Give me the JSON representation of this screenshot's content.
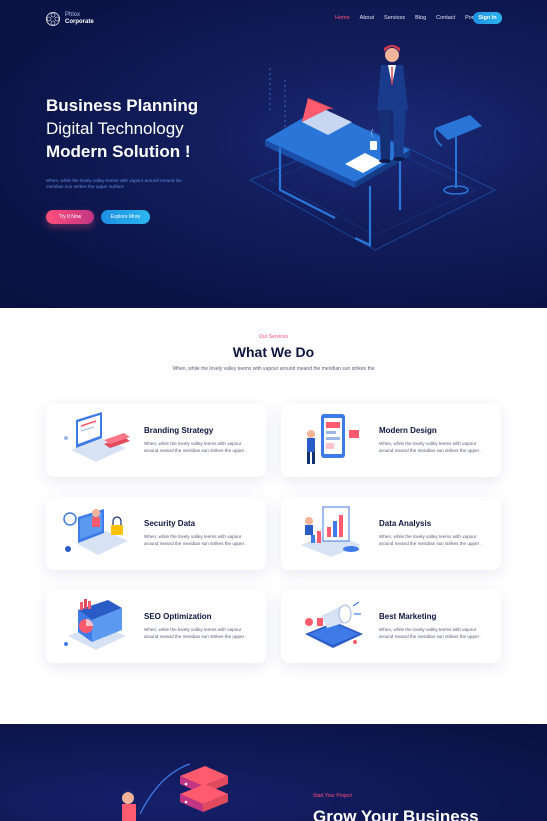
{
  "brand": {
    "line1": "Phlox",
    "line2": "Corporate"
  },
  "nav": {
    "items": [
      {
        "label": "Home"
      },
      {
        "label": "About"
      },
      {
        "label": "Services"
      },
      {
        "label": "Blog"
      },
      {
        "label": "Contact"
      },
      {
        "label": "Portfolio"
      }
    ],
    "signin": "Sign In",
    "active_color": "#ff4f7b"
  },
  "hero": {
    "line1": "Business Planning",
    "line2": "Digital Technology",
    "line3": "Modern Solution !",
    "subtitle": "When, while the lovely valley teems with vapour around meand the meridian sun strikes the upper surface",
    "btn_primary": "Try It Now",
    "btn_secondary": "Explore More"
  },
  "services": {
    "eyebrow": "Our Services",
    "title_bold": "What",
    "title_rest": " We Do",
    "description": "When, while the lovely valley teems with vapour around meand the meridian sun strikes the",
    "cards": [
      {
        "title": "Branding Strategy",
        "text": "When, while the lovely valley teems with vapour around meand the meridian sun strikes the upper .",
        "icon": "laptop-books-icon"
      },
      {
        "title": "Modern Design",
        "text": "When, while the lovely valley teems with vapour around meand the meridian sun strikes the upper .",
        "icon": "mobile-design-icon"
      },
      {
        "title": "Security Data",
        "text": "When, while the lovely valley teems with vapour around meand the meridian sun strikes the upper .",
        "icon": "security-laptop-icon"
      },
      {
        "title": "Data Analysis",
        "text": "When, while the lovely valley teems with vapour around meand the meridian sun strikes the upper .",
        "icon": "analytics-chart-icon"
      },
      {
        "title": "SEO Optimization",
        "text": "When, while the lovely valley teems with vapour around meand the meridian sun strikes the upper .",
        "icon": "seo-monitor-icon"
      },
      {
        "title": "Best Marketing",
        "text": "When, while the lovely valley teems with vapour around meand the meridian sun strikes the upper .",
        "icon": "megaphone-phone-icon"
      }
    ]
  },
  "cta": {
    "eyebrow": "Start Your Project",
    "title": "Grow Your Business"
  },
  "colors": {
    "navy": "#0b1447",
    "pink": "#ff4f7b",
    "blue": "#1d8fe1"
  }
}
